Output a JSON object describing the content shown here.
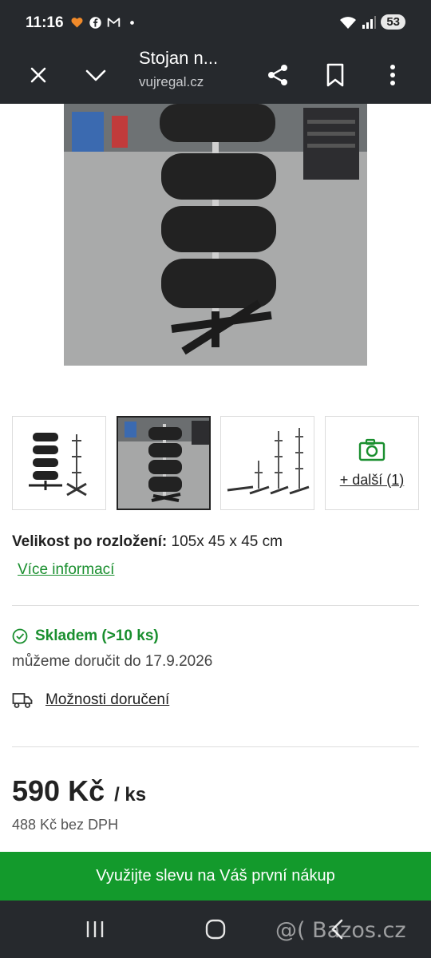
{
  "status_bar": {
    "time": "11:16",
    "battery": "53",
    "notification_icons": [
      "heart-icon",
      "facebook-icon",
      "gmail-icon",
      "dot-icon"
    ]
  },
  "browser": {
    "title": "Stojan n...",
    "url": "vujregal.cz"
  },
  "gallery": {
    "more_label": "+ další (1)",
    "selected_index": 1
  },
  "spec": {
    "label": "Velikost po rozložení:",
    "value": " 105x 45 x 45 cm",
    "more_info": "Více informací"
  },
  "stock": {
    "status": "Skladem (>10 ks)",
    "delivery": "můžeme doručit do 17.9.2026",
    "delivery_options": "Možnosti doručení"
  },
  "price": {
    "value": "590 Kč",
    "unit": "/ ks",
    "no_vat": "488 Kč bez DPH"
  },
  "promo": {
    "text": "Využijte slevu na Váš první nákup"
  },
  "watermark": "@( Bazos.cz",
  "colors": {
    "accent_green": "#139a2c",
    "link_green": "#1a8f2f",
    "chrome_dark": "#26292d"
  }
}
